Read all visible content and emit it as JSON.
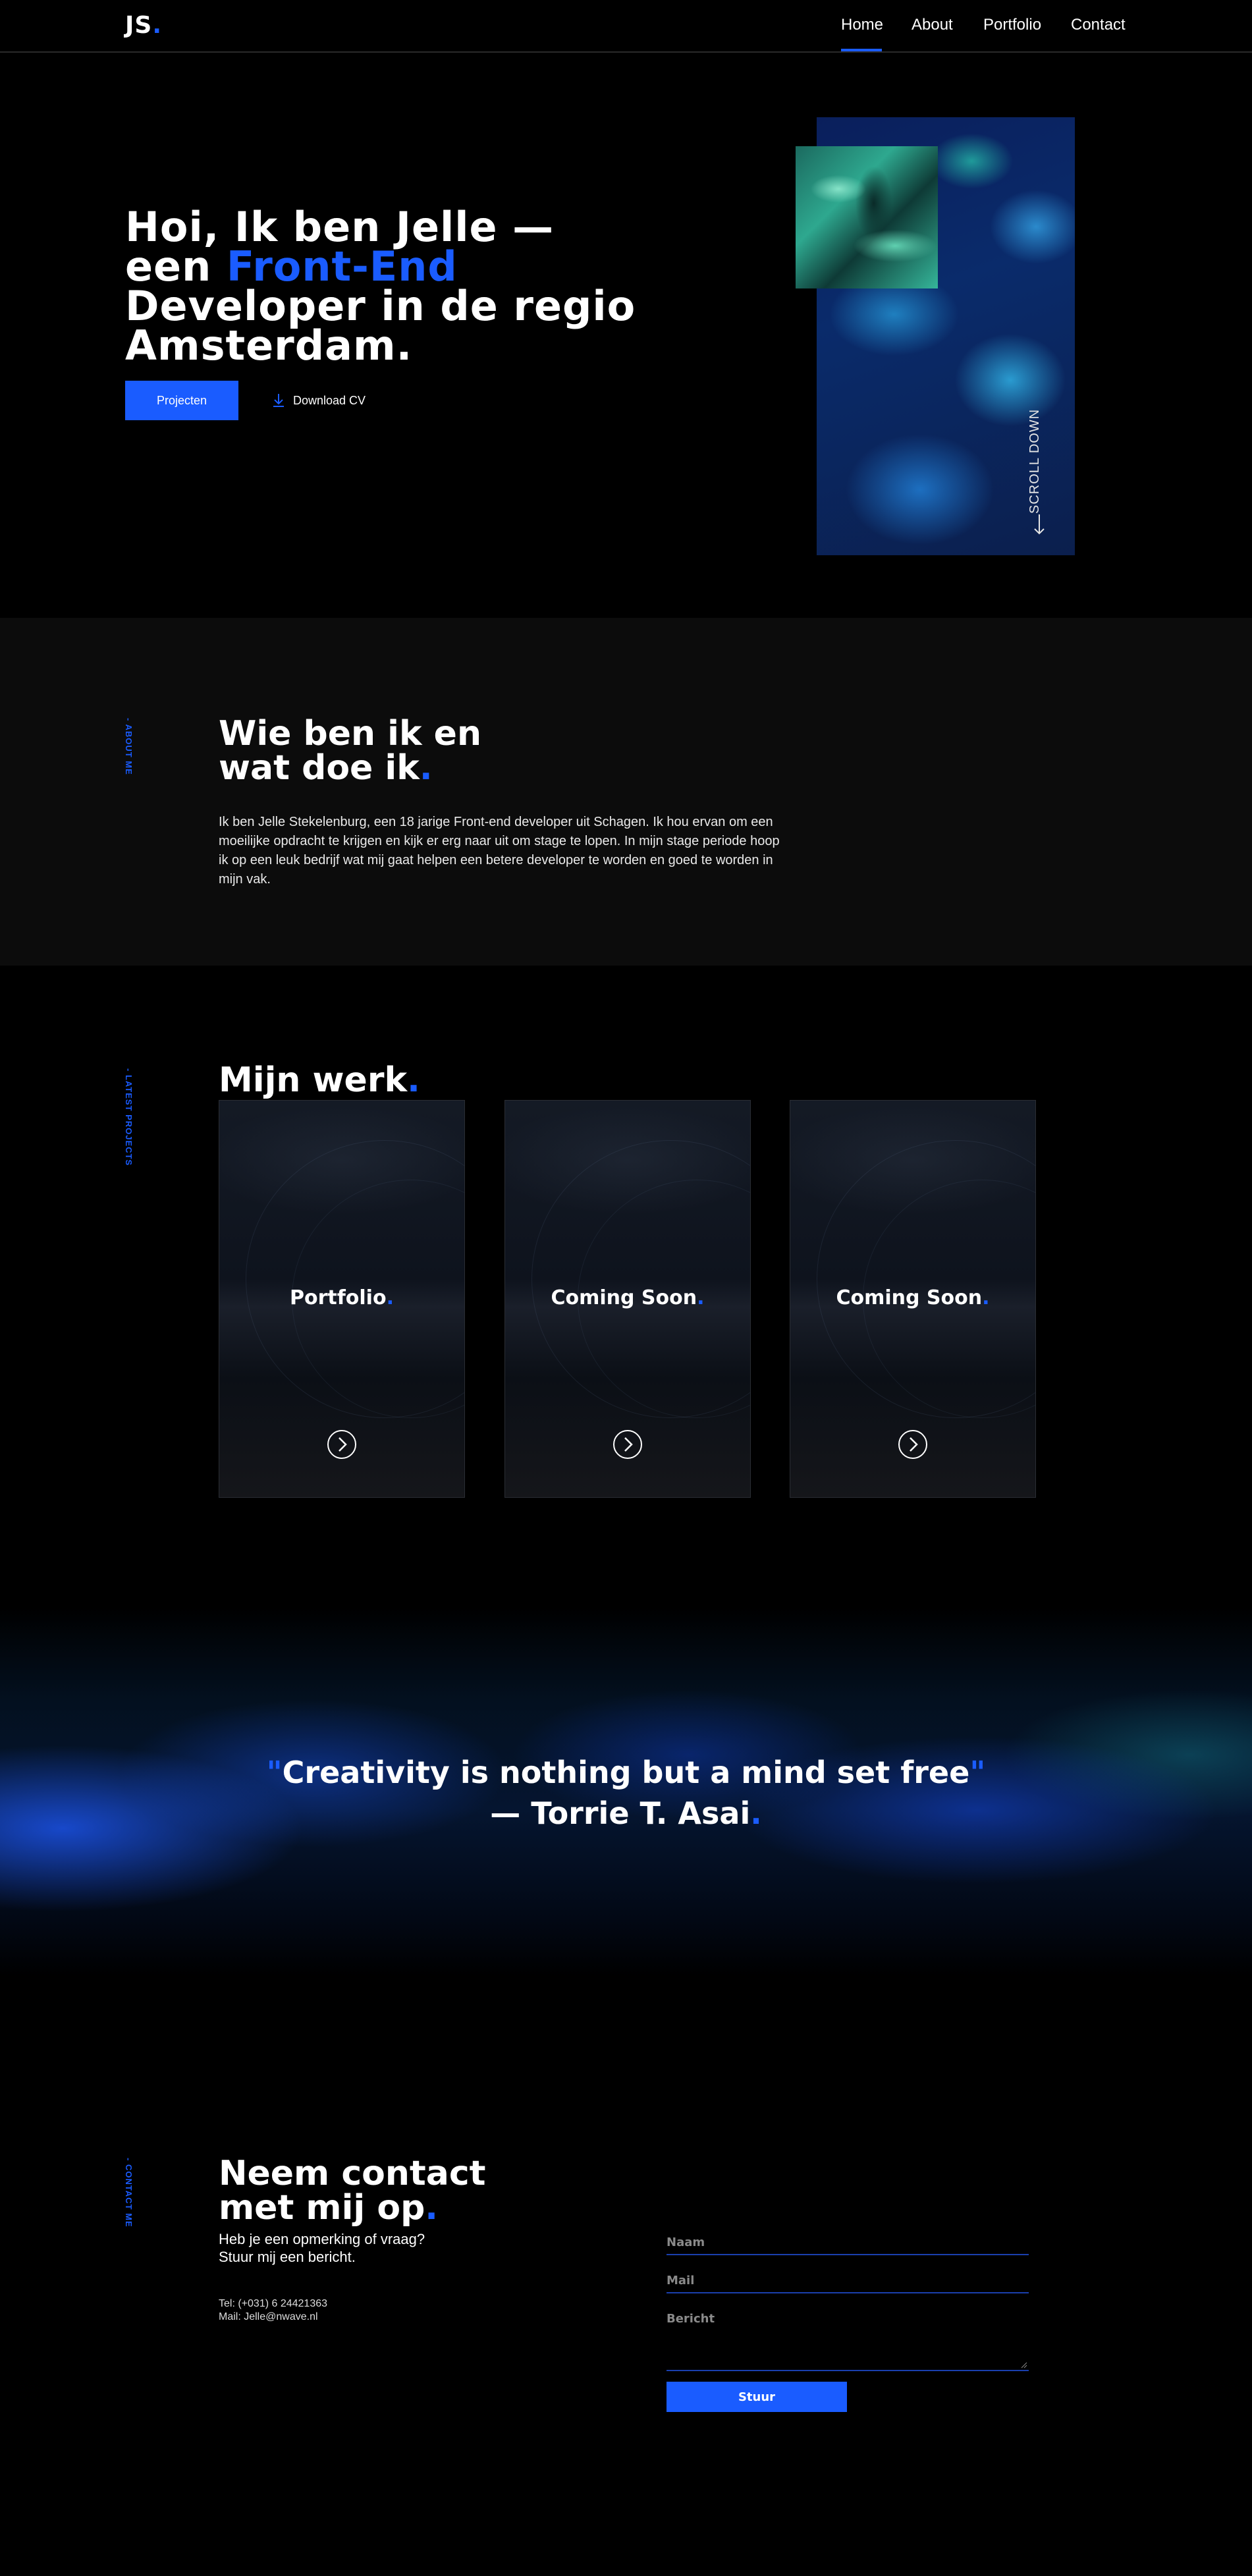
{
  "nav": {
    "logo_text": "JS",
    "logo_dot": ".",
    "items": [
      "Home",
      "About",
      "Portfolio",
      "Contact"
    ],
    "active": "Home"
  },
  "hero": {
    "line1": "Hoi, Ik ben Jelle —",
    "line2_prefix": "een ",
    "line2_accent": "Front-End",
    "line3": "Developer in de regio",
    "line4": "Amsterdam.",
    "primary_button": "Projecten",
    "secondary_button": "Download CV",
    "scroll_label": "SCROLL DOWN"
  },
  "about": {
    "side_label": "- ABOUT ME",
    "title_line1": "Wie ben ik en",
    "title_line2": "wat doe ik",
    "title_dot": ".",
    "body": "Ik ben Jelle Stekelenburg, een 18 jarige Front-end developer uit Schagen. Ik hou ervan om een moeilijke opdracht te krijgen en kijk er erg naar uit om stage te lopen. In mijn stage periode hoop ik op een leuk bedrijf wat mij gaat helpen een betere developer te worden en goed te worden in mijn vak."
  },
  "work": {
    "side_label": "- LATEST PROJECTS",
    "title": "Mijn werk",
    "title_dot": ".",
    "cards": [
      {
        "title": "Portfolio",
        "dot": "."
      },
      {
        "title": "Coming Soon",
        "dot": "."
      },
      {
        "title": "Coming Soon",
        "dot": "."
      }
    ]
  },
  "quote": {
    "open": "\"",
    "text": "Creativity is nothing but a mind set free",
    "close": "\"",
    "author": "— Torrie T. Asai",
    "author_dot": "."
  },
  "contact": {
    "side_label": "- CONTACT ME",
    "title_line1": "Neem contact",
    "title_line2": "met mij op",
    "title_dot": ".",
    "sub_line1": "Heb je een opmerking of vraag?",
    "sub_line2": "Stuur mij een bericht.",
    "phone": "Tel: (+031) 6 24421363",
    "mail": "Mail: Jelle@nwave.nl",
    "form": {
      "name_placeholder": "Naam",
      "mail_placeholder": "Mail",
      "message_placeholder": "Bericht",
      "submit": "Stuur"
    }
  },
  "colors": {
    "accent": "#1a5cff",
    "background": "#000000",
    "section_alt": "#0c0c0c"
  }
}
